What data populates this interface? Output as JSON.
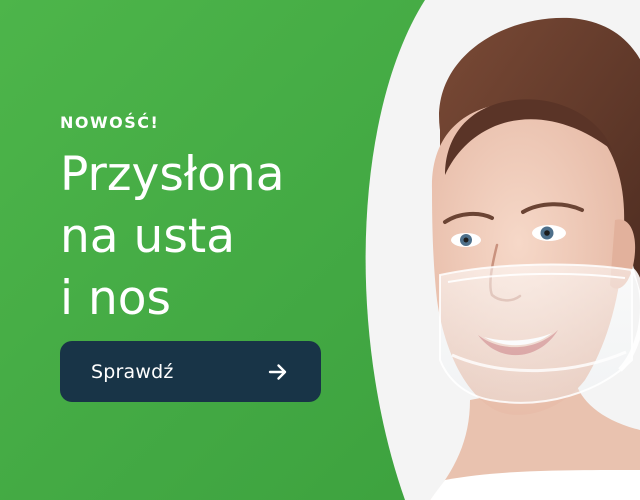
{
  "banner": {
    "eyebrow": "NOWOŚĆ!",
    "headline_lines": [
      "Przysłona",
      "na usta",
      "i nos"
    ],
    "cta": {
      "label": "Sprawdź",
      "icon": "arrow-right-icon"
    }
  },
  "colors": {
    "background_green": "#42a843",
    "button_navy": "#183447",
    "text_white": "#ffffff",
    "photo_background": "#f4f4f4"
  }
}
